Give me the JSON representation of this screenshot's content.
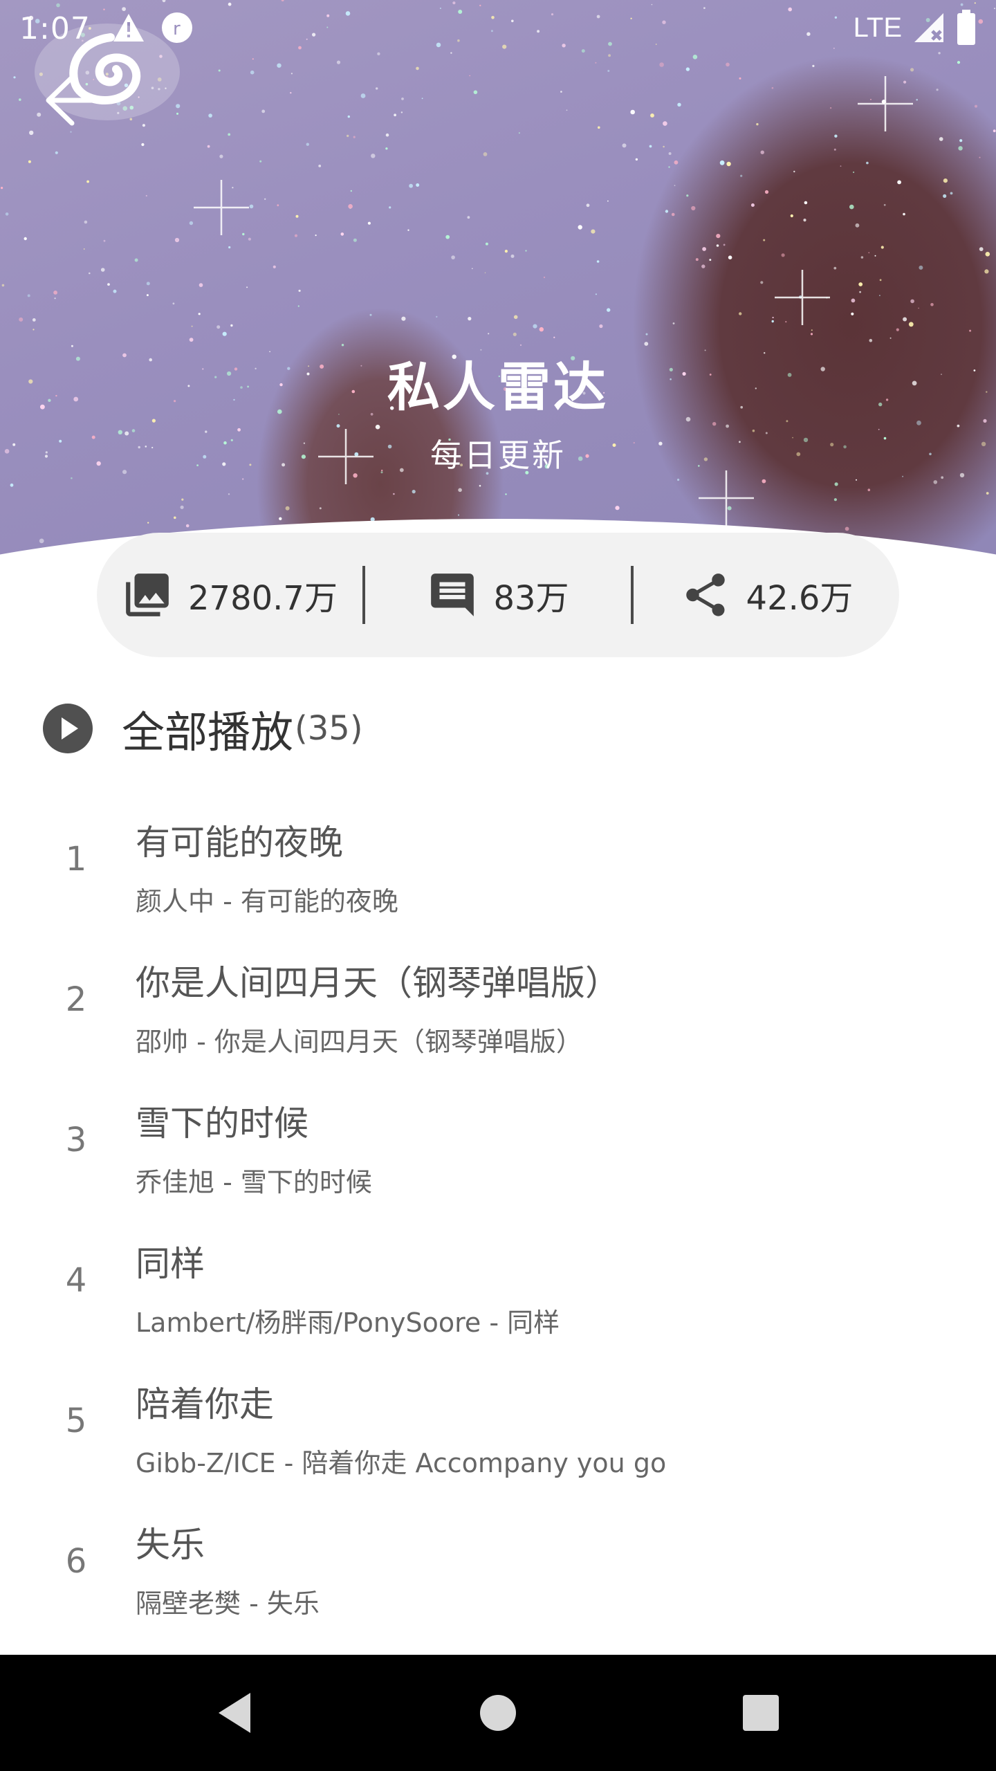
{
  "status_bar": {
    "time": "1:07",
    "network": "LTE"
  },
  "header": {
    "title": "私人雷达",
    "subtitle": "每日更新"
  },
  "stats": {
    "plays": "2780.7万",
    "comments": "83万",
    "shares": "42.6万"
  },
  "play_all": {
    "label": "全部播放",
    "count": "(35)"
  },
  "songs": [
    {
      "index": "1",
      "title": "有可能的夜晚",
      "subtitle": "颜人中 - 有可能的夜晚"
    },
    {
      "index": "2",
      "title": "你是人间四月天（钢琴弹唱版）",
      "subtitle": "邵帅 - 你是人间四月天（钢琴弹唱版）"
    },
    {
      "index": "3",
      "title": "雪下的时候",
      "subtitle": "乔佳旭 - 雪下的时候"
    },
    {
      "index": "4",
      "title": "同样",
      "subtitle": "Lambert/杨胖雨/PonySoore - 同样"
    },
    {
      "index": "5",
      "title": "陪着你走",
      "subtitle": "Gibb-Z/ICE - 陪着你走 Accompany you go"
    },
    {
      "index": "6",
      "title": "失乐",
      "subtitle": "隔壁老樊 - 失乐"
    }
  ],
  "icons": {
    "back": "arrow-left-icon",
    "logo": "netease-music-logo",
    "plays": "image-stack-icon",
    "comments": "comment-icon",
    "shares": "share-icon",
    "play_all": "play-circle-icon"
  },
  "colors": {
    "hero_bg": "#9a8fbe",
    "pill_bg": "#f2f2f2",
    "nav_bg": "#000000"
  }
}
